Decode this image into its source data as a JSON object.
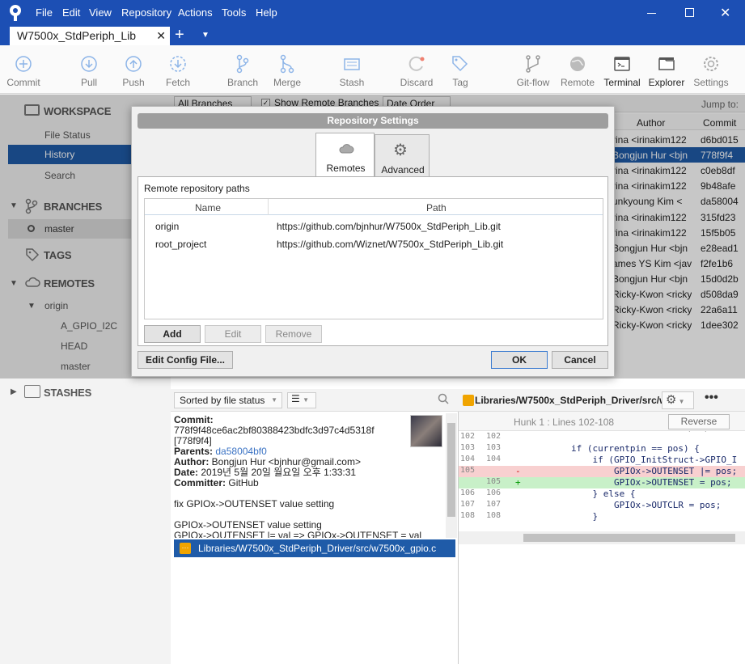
{
  "menu": [
    "File",
    "Edit",
    "View",
    "Repository",
    "Actions",
    "Tools",
    "Help"
  ],
  "tab": {
    "title": "W7500x_StdPeriph_Lib"
  },
  "toolbar": [
    {
      "label": "Commit",
      "icon": "plus-circle-icon"
    },
    {
      "label": "Pull",
      "icon": "pull-icon"
    },
    {
      "label": "Push",
      "icon": "push-icon"
    },
    {
      "label": "Fetch",
      "icon": "fetch-icon"
    },
    {
      "label": "Branch",
      "icon": "branch-icon"
    },
    {
      "label": "Merge",
      "icon": "merge-icon"
    },
    {
      "label": "Stash",
      "icon": "stash-icon"
    },
    {
      "label": "Discard",
      "icon": "discard-icon"
    },
    {
      "label": "Tag",
      "icon": "tag-icon"
    },
    {
      "label": "Git-flow",
      "icon": "gitflow-icon"
    },
    {
      "label": "Remote",
      "icon": "globe-icon"
    },
    {
      "label": "Terminal",
      "icon": "terminal-icon"
    },
    {
      "label": "Explorer",
      "icon": "explorer-icon"
    },
    {
      "label": "Settings",
      "icon": "gear-icon"
    }
  ],
  "sidebar": {
    "workspace": "WORKSPACE",
    "file_status": "File Status",
    "history": "History",
    "search": "Search",
    "branches": "BRANCHES",
    "master": "master",
    "tags": "TAGS",
    "remotes": "REMOTES",
    "origin": "origin",
    "remote_branches": [
      "A_GPIO_I2C",
      "HEAD",
      "master"
    ],
    "stashes": "STASHES"
  },
  "log_toolbar": {
    "branches": "All Branches",
    "show_remote": "Show Remote Branches",
    "order": "Date Order",
    "jump": "Jump to:"
  },
  "log": {
    "headers": {
      "author": "Author",
      "commit": "Commit"
    },
    "rows": [
      {
        "author": "rina <irinakim122",
        "commit": "d6bd015"
      },
      {
        "author": "Bongjun Hur <bjn",
        "commit": "778f9f4"
      },
      {
        "author": "rina <irinakim122",
        "commit": "c0eb8df"
      },
      {
        "author": "rina <irinakim122",
        "commit": "9b48afe"
      },
      {
        "author": "unkyoung Kim <",
        "commit": "da58004"
      },
      {
        "author": "rina <irinakim122",
        "commit": "315fd23"
      },
      {
        "author": "rina <irinakim122",
        "commit": "15f5b05"
      },
      {
        "author": "Bongjun Hur <bjn",
        "commit": "e28ead1"
      },
      {
        "author": "ames YS Kim <jav",
        "commit": "f2fe1b6"
      },
      {
        "author": "Bongjun Hur <bjn",
        "commit": "15d0d2b"
      },
      {
        "author": "Ricky-Kwon <ricky",
        "commit": "d508da9"
      },
      {
        "author": "Ricky-Kwon <ricky",
        "commit": "22a6a11"
      },
      {
        "author": "Ricky-Kwon <ricky",
        "commit": "1dee302"
      }
    ]
  },
  "details": {
    "sort": "Sorted by file status",
    "commit_label": "Commit:",
    "commit_hash": "778f9f48ce6ac2bf80388423bdfc3d97c4d5318f",
    "commit_short": "[778f9f4]",
    "parents_label": "Parents:",
    "parents": "da58004bf0",
    "author_label": "Author:",
    "author": "Bongjun Hur <bjnhur@gmail.com>",
    "date_label": "Date:",
    "date": "2019년 5월 20일 월요일 오후 1:33:31",
    "committer_label": "Committer:",
    "committer": "GitHub",
    "message1": "fix GPIOx->OUTENSET value setting",
    "message2": "GPIOx->OUTENSET value setting",
    "message3": "GPIOx->OUTENSET |= val => GPIOx->OUTENSET = val",
    "file": "Libraries/W7500x_StdPeriph_Driver/src/w7500x_gpio.c"
  },
  "diff": {
    "file": "Libraries/W7500x_StdPeriph_Driver/src/w...",
    "hunk": "Hunk 1 : Lines 102-108",
    "reverse": "Reverse hunk",
    "lines": [
      {
        "old": "102",
        "new": "102",
        "sign": "",
        "code": "",
        "type": "ctx"
      },
      {
        "old": "103",
        "new": "103",
        "sign": "",
        "code": "        if (currentpin == pos) {",
        "type": "ctx"
      },
      {
        "old": "104",
        "new": "104",
        "sign": "",
        "code": "            if (GPIO_InitStruct->GPIO_I",
        "type": "ctx"
      },
      {
        "old": "105",
        "new": "",
        "sign": "-",
        "code": "                GPIOx->OUTENSET |= pos;",
        "type": "del"
      },
      {
        "old": "",
        "new": "105",
        "sign": "+",
        "code": "                GPIOx->OUTENSET = pos;",
        "type": "add"
      },
      {
        "old": "106",
        "new": "106",
        "sign": "",
        "code": "            } else {",
        "type": "ctx"
      },
      {
        "old": "107",
        "new": "107",
        "sign": "",
        "code": "                GPIOx->OUTCLR = pos;",
        "type": "ctx"
      },
      {
        "old": "108",
        "new": "108",
        "sign": "",
        "code": "            }",
        "type": "ctx"
      }
    ]
  },
  "dialog": {
    "title": "Repository Settings",
    "tab_remotes": "Remotes",
    "tab_advanced": "Advanced",
    "section": "Remote repository paths",
    "col_name": "Name",
    "col_path": "Path",
    "remotes": [
      {
        "name": "origin",
        "path": "https://github.com/bjnhur/W7500x_StdPeriph_Lib.git"
      },
      {
        "name": "root_project",
        "path": "https://github.com/Wiznet/W7500x_StdPeriph_Lib.git"
      }
    ],
    "add": "Add",
    "edit": "Edit",
    "remove": "Remove",
    "edit_config": "Edit Config File...",
    "ok": "OK",
    "cancel": "Cancel"
  },
  "colors": {
    "titlebar": "#1c4fb4",
    "selection": "#1f5ba8",
    "added": "#c8f0c8",
    "deleted": "#f8d0d0"
  }
}
